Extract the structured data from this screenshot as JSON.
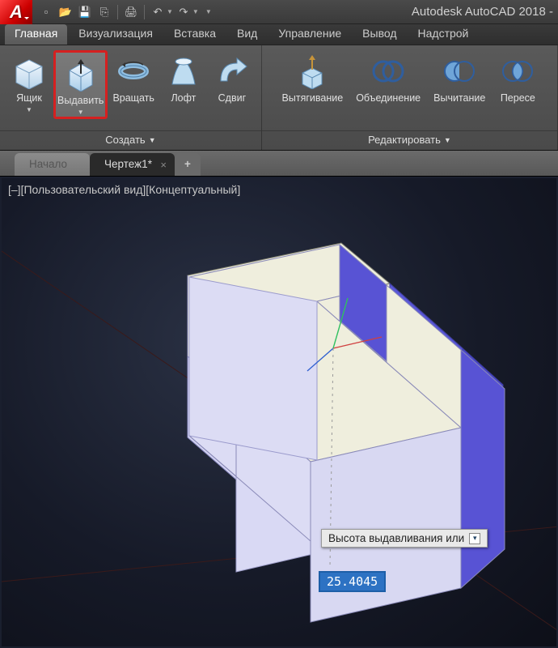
{
  "app": {
    "title": "Autodesk AutoCAD 2018 -",
    "logo_letter": "A"
  },
  "qat": {
    "items": [
      "new",
      "open",
      "save",
      "saveas",
      "print",
      "undo",
      "redo"
    ]
  },
  "ribbon": {
    "tabs": [
      {
        "label": "Главная",
        "active": true
      },
      {
        "label": "Визуализация"
      },
      {
        "label": "Вставка"
      },
      {
        "label": "Вид"
      },
      {
        "label": "Управление"
      },
      {
        "label": "Вывод"
      },
      {
        "label": "Надстрой"
      }
    ],
    "panels": [
      {
        "title": "Создать",
        "tools": [
          {
            "key": "box",
            "label": "Ящик",
            "has_drop": true
          },
          {
            "key": "extrude",
            "label": "Выдавить",
            "has_drop": true,
            "highlighted": true
          },
          {
            "key": "revolve",
            "label": "Вращать"
          },
          {
            "key": "loft",
            "label": "Лофт"
          },
          {
            "key": "sweep",
            "label": "Сдвиг"
          }
        ]
      },
      {
        "title": "Редактировать",
        "tools": [
          {
            "key": "presspull",
            "label": "Вытягивание"
          },
          {
            "key": "union",
            "label": "Объединение"
          },
          {
            "key": "subtract",
            "label": "Вычитание"
          },
          {
            "key": "intersect",
            "label": "Пересе"
          }
        ]
      }
    ]
  },
  "doc_tabs": [
    {
      "label": "Начало",
      "active": false,
      "closable": false
    },
    {
      "label": "Чертеж1*",
      "active": true,
      "closable": true
    }
  ],
  "viewport": {
    "label": "[–][Пользовательский вид][Концептуальный]",
    "tooltip": "Высота выдавливания или",
    "input_value": "25.4045"
  }
}
